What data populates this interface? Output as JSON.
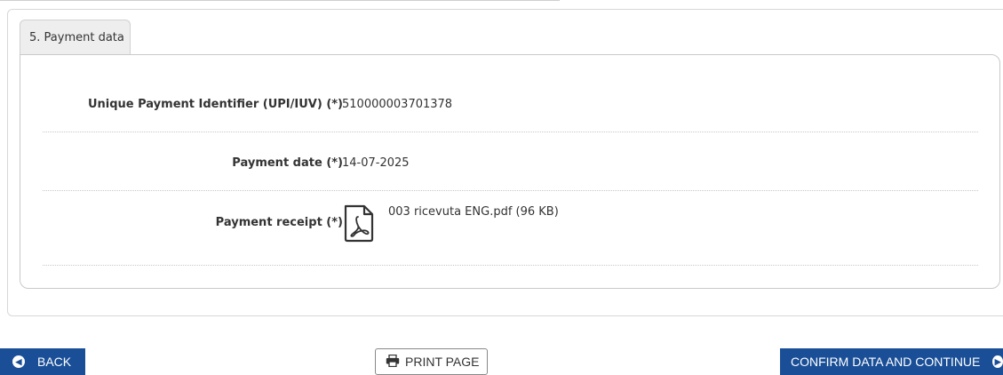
{
  "section": {
    "tab_label": "5. Payment data"
  },
  "fields": {
    "upi": {
      "label": "Unique Payment Identifier (UPI/IUV) (*)",
      "value": "510000003701378"
    },
    "date": {
      "label": "Payment date (*)",
      "value": "14-07-2025"
    },
    "receipt": {
      "label": "Payment receipt (*)",
      "file": "003 ricevuta ENG.pdf (96 KB)",
      "icon": "pdf-file-icon"
    }
  },
  "buttons": {
    "back": "BACK",
    "print": "PRINT PAGE",
    "confirm": "CONFIRM DATA AND CONTINUE"
  },
  "colors": {
    "primary": "#1a4f97",
    "border": "#c9c9c9",
    "tab_bg": "#eeeeee"
  }
}
